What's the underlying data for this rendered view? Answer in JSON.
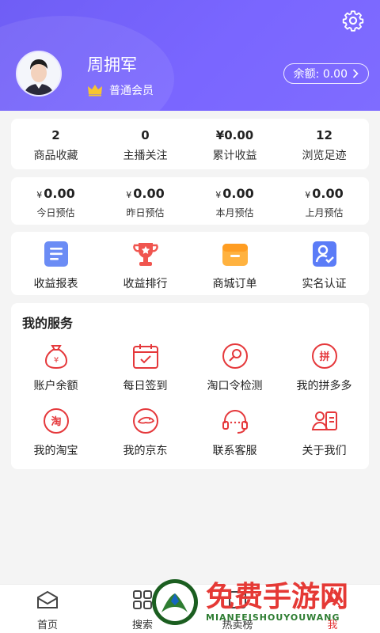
{
  "profile": {
    "name": "周拥军",
    "member_level": "普通会员",
    "balance_label": "余额: 0.00"
  },
  "stats": [
    {
      "value": "2",
      "label": "商品收藏"
    },
    {
      "value": "0",
      "label": "主播关注"
    },
    {
      "value": "¥0.00",
      "label": "累计收益"
    },
    {
      "value": "12",
      "label": "浏览足迹"
    }
  ],
  "estimates": [
    {
      "currency": "¥",
      "value": "0.00",
      "label": "今日预估"
    },
    {
      "currency": "¥",
      "value": "0.00",
      "label": "昨日预估"
    },
    {
      "currency": "¥",
      "value": "0.00",
      "label": "本月预估"
    },
    {
      "currency": "¥",
      "value": "0.00",
      "label": "上月预估"
    }
  ],
  "reports": [
    {
      "label": "收益报表",
      "icon": "report-icon"
    },
    {
      "label": "收益排行",
      "icon": "trophy-icon"
    },
    {
      "label": "商城订单",
      "icon": "order-box-icon"
    },
    {
      "label": "实名认证",
      "icon": "id-verify-icon"
    }
  ],
  "services": {
    "title": "我的服务",
    "items": [
      {
        "label": "账户余额",
        "icon": "money-bag-icon"
      },
      {
        "label": "每日签到",
        "icon": "calendar-check-icon"
      },
      {
        "label": "淘口令检测",
        "icon": "search-circle-icon"
      },
      {
        "label": "我的拼多多",
        "icon": "pinduoduo-icon"
      },
      {
        "label": "我的淘宝",
        "icon": "taobao-icon"
      },
      {
        "label": "我的京东",
        "icon": "jd-icon"
      },
      {
        "label": "联系客服",
        "icon": "headset-icon"
      },
      {
        "label": "关于我们",
        "icon": "about-card-icon"
      }
    ]
  },
  "tabbar": [
    {
      "label": "首页",
      "icon": "home-icon"
    },
    {
      "label": "搜索",
      "icon": "grid-icon"
    },
    {
      "label": "热卖榜",
      "icon": "hot-list-icon"
    },
    {
      "label": "我",
      "icon": "me-icon"
    }
  ],
  "watermark": {
    "title": "免费手游网",
    "subtitle": "MIANFEISHOUYOUWANG"
  },
  "colors": {
    "header": "#7a66ff",
    "accent_red": "#e5383b",
    "icon_blue": "#5b7cf7",
    "icon_orange": "#ffa531"
  }
}
